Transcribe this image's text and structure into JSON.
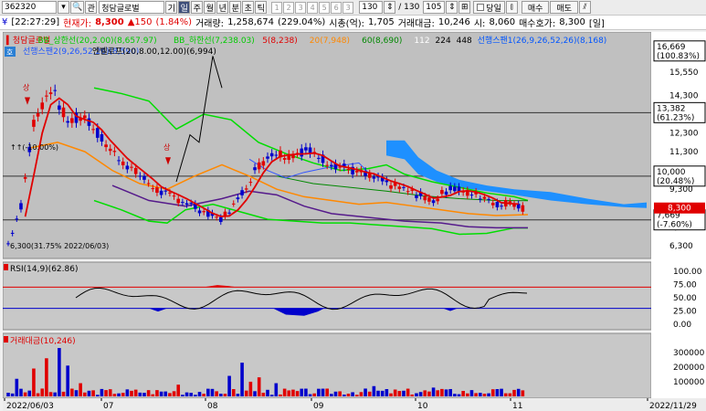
{
  "toolbar": {
    "code": "362320",
    "code_btn": "▾",
    "search_icon": "🔍",
    "rel_label": "관",
    "name": "청담글로벌",
    "gi_label": "기",
    "period_tabs": [
      "일",
      "주",
      "월",
      "년",
      "분",
      "초",
      "틱"
    ],
    "period_active": "일",
    "minute_slots": [
      "1",
      "2",
      "3",
      "4",
      "5",
      "6",
      "3"
    ],
    "count_value": "130",
    "count_total": "/ 130",
    "zoom_value": "105",
    "today_label": "당일",
    "buy_label": "매수",
    "sell_label": "매도",
    "tool_labels": [
      "⊞",
      "⫾",
      "⫽"
    ]
  },
  "info": {
    "time": "[22:27:29]",
    "price_label": "현재가:",
    "price": "8,300",
    "change": "▲150",
    "change_pct": "(1.84%)",
    "volume_label": "거래량:",
    "volume": "1,258,674",
    "volume_pct": "(229.04%)",
    "mcap_label": "시총(억):",
    "mcap": "1,705",
    "amount_label": "거래대금:",
    "amount": "10,246",
    "open_label": "시:",
    "open": "8,060",
    "bid_label": "매수호가:",
    "bid": "8,300",
    "mode": "[일]"
  },
  "legend": {
    "main": [
      {
        "text": "청담글로벌",
        "color": "#e00000"
      },
      {
        "text": "BB_상한선(20,2.00)(8,657.97)",
        "color": "#00cc00"
      },
      {
        "text": "BB_하한선(7,238.03)",
        "color": "#00cc00"
      },
      {
        "text": "5(8,238)",
        "color": "#e00000"
      },
      {
        "text": "20(7,948)",
        "color": "#ff8800"
      },
      {
        "text": "60(8,690)",
        "color": "#008800"
      },
      {
        "text": "112",
        "color": "#ffffff"
      },
      {
        "text": "224",
        "color": "#000000"
      },
      {
        "text": "448",
        "color": "#000000"
      },
      {
        "text": "선행스팬1(26,9,26,52,26)(8,168)",
        "color": "#0055ff"
      }
    ],
    "second": "선행스팬2(9,26,52,26)(8,590)",
    "third": "엔벨로프(20,8.00,12.00)(6,994)",
    "hint_icon": "호"
  },
  "annotations": {
    "sang1": "상",
    "sang2": "상",
    "low_note": "6,300(31.75% 2022/06/03)",
    "pivot_note": "↑↑(-10.00%)"
  },
  "price_axis": {
    "ticks": [
      "15,550",
      "14,300",
      "13,382",
      "12,300",
      "11,300",
      "10,000",
      "9,300",
      "8,300",
      "7,669",
      "7,300",
      "6,300"
    ],
    "boxes": [
      {
        "value": "16,669",
        "pct": "(100.83%)"
      },
      {
        "value": "13,382",
        "pct": "(61.23%)"
      },
      {
        "value": "10,000",
        "pct": "(20.48%)"
      },
      {
        "value": "7,669",
        "pct": "(-7.60%)"
      }
    ],
    "current": "8,300"
  },
  "rsi": {
    "label": "RSI(14,9)(62.86)",
    "ticks": [
      "100.00",
      "75.00",
      "50.00",
      "25.00",
      "0.00"
    ]
  },
  "amount_panel": {
    "label": "거래대금(10,246)",
    "ticks": [
      "300000",
      "200000",
      "100000"
    ]
  },
  "dates": [
    "2022/06/03",
    "07",
    "08",
    "09",
    "10",
    "11",
    "2022/11/29"
  ],
  "colors": {
    "bg": "#c0c0c0",
    "up": "#e00000",
    "down": "#0000cc",
    "bb": "#00dd00",
    "ma20": "#ff8800",
    "ma60": "#008800",
    "ma_purple": "#551a8b",
    "cloud": "#1e90ff"
  }
}
